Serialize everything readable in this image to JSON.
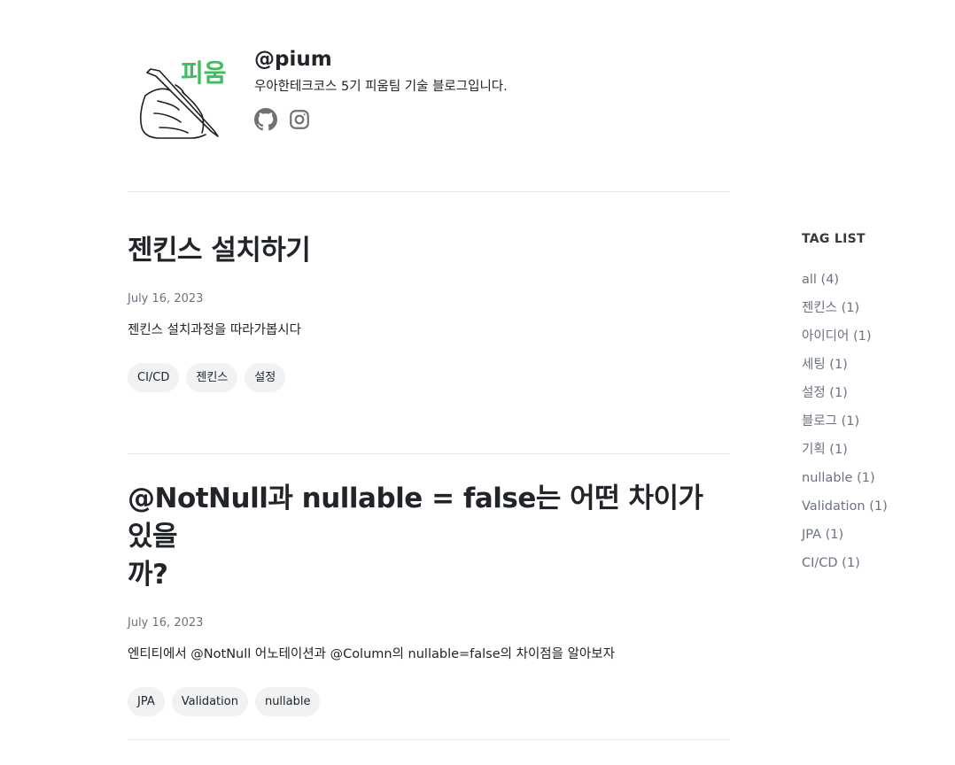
{
  "profile": {
    "author": "@pium",
    "description": "우아한테크코스 5기 피움팀 기술 블로그입니다.",
    "logo_text": "피움",
    "social": [
      {
        "name": "github-icon"
      },
      {
        "name": "instagram-icon"
      }
    ]
  },
  "posts": [
    {
      "title": "젠킨스 설치하기",
      "date": "July 16, 2023",
      "description": "젠킨스 설치과정을 따라가봅시다",
      "tags": [
        "CI/CD",
        "젠킨스",
        "설정"
      ]
    },
    {
      "title_line1": "@NotNull과 nullable = false는 어떤 차이가 있을",
      "title_line2": "까?",
      "date": "July 16, 2023",
      "description": "엔티티에서 @NotNull 어노테이션과 @Column의 nullable=false의 차이점을 알아보자",
      "tags": [
        "JPA",
        "Validation",
        "nullable"
      ]
    }
  ],
  "taglist": {
    "title": "TAG LIST",
    "items": [
      "all (4)",
      "젠킨스 (1)",
      "아이디어 (1)",
      "세팅 (1)",
      "설정 (1)",
      "블로그 (1)",
      "기획 (1)",
      "nullable (1)",
      "Validation (1)",
      "JPA (1)",
      "CI/CD (1)"
    ]
  },
  "colors": {
    "logo_green": "#3dbd5d",
    "text": "#212529",
    "muted": "#6b7280",
    "tag_bg": "#f1f2f3"
  }
}
